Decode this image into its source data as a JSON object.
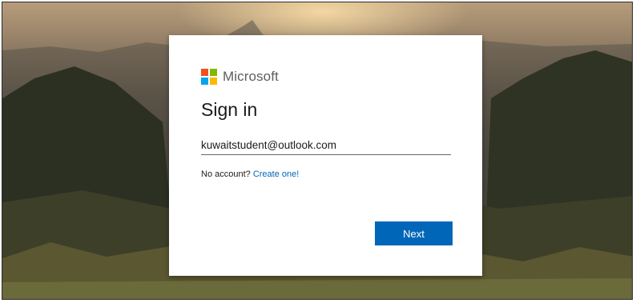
{
  "brand": {
    "logo_text": "Microsoft",
    "colors": {
      "red": "#f25022",
      "green": "#7fba00",
      "blue": "#00a4ef",
      "yellow": "#ffb900"
    }
  },
  "signin": {
    "title": "Sign in",
    "email_value": "kuwaitstudent@outlook.com",
    "no_account_text": "No account?",
    "create_link": "Create one!",
    "next_label": "Next"
  },
  "accent_color": "#0067b8"
}
